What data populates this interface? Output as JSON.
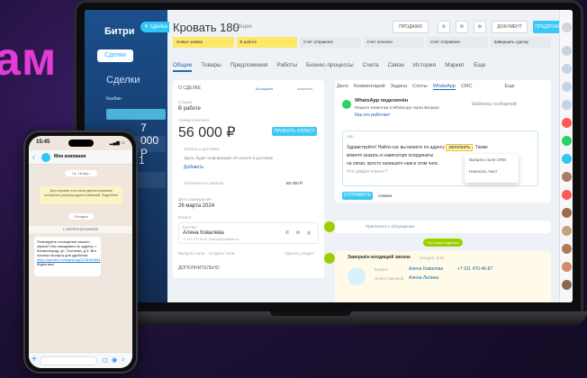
{
  "headline": "ам",
  "crm": {
    "brand": "Битри",
    "left_button": "Сделки",
    "section": "Сделки",
    "kanban": "Канбан",
    "amount_1": "7 000 Р",
    "amount_2": "1"
  },
  "deal": {
    "close_label": "сделка",
    "title": "Кровать 180",
    "subtitle": "Общие",
    "buttons": [
      "ПРОДАЖИ",
      "ДОКУМЕНТ",
      "ПРЕДЛОЖЕНИЕ"
    ],
    "stages": [
      {
        "label": "Новые заявки",
        "color": "#ffe769"
      },
      {
        "label": "В работе",
        "color": "#ffe769"
      },
      {
        "label": "Счет отправлен",
        "color": "#e6e9ed"
      },
      {
        "label": "Счет оплачен",
        "color": "#e6e9ed"
      },
      {
        "label": "Счет отправлен",
        "color": "#e6e9ed"
      },
      {
        "label": "Завершить сделку",
        "color": "#e6e9ed"
      }
    ],
    "tabs": [
      "Общие",
      "Товары",
      "Предложения",
      "Работы",
      "Бизнес-процессы",
      "Счета",
      "Связи",
      "История",
      "Маркет",
      "Еще"
    ],
    "about_title": "О СДЕЛКЕ",
    "ai_label": "AI-скоринг",
    "edit_label": "изменить",
    "stage_label": "Стадия",
    "stage_value": "В работе",
    "amount_label": "Сумма и валюта",
    "amount_value": "56 000 ₽",
    "payment_button": "ПРИНЯТЬ ОПЛАТУ",
    "payment_label": "Оплата и доставка",
    "payment_note": "Здесь будет информация об оплате и доставке",
    "add_link": "Добавить",
    "delivered": "Оплачено из заказов",
    "delivered_value": "56 000 ₽",
    "date_label": "Дата завершения",
    "date_value": "26 марта 2024",
    "client_label": "Клиент",
    "contact_label": "Контакт",
    "contact_name": "Алена Ковалева",
    "contact_phone": "+7 911 470-46-87, lhalena@lalalalala.ru",
    "select_field": "Выбрать поле",
    "create_field": "Создать поле",
    "delete_section": "Удалить раздел",
    "extra_title": "ДОПОЛНИТЕЛЬНО"
  },
  "activity": {
    "tabs": [
      "Дело",
      "Комментарий",
      "Задача",
      "Слоты",
      "WhatsApp",
      "СМС",
      "Еще"
    ],
    "wa_connected": "WhatsApp подключён",
    "wa_desc": "Пишите клиентам в WhatsApp через Битрикс",
    "how_link": "Как это работает",
    "templates": "Шаблоны сообщений",
    "from_label": "пер",
    "message_1": "Здравствуйте! Найти нас вы можете по адресу",
    "fill": "заполнить",
    "message_2": ". Также",
    "message_3": "можете указать в навигаторе координаты",
    "message_4": "на связи, просто напишите нам в этом чате.",
    "message_5": "Что увидит клиент?",
    "popup_1": "Выбрать поле CRM",
    "popup_2": "Написать текст",
    "send_button": "ОТПРАВИТЬ",
    "cancel_button": "отмена",
    "invite": "Пригласить к обсуждению",
    "need_work": "Что нужно сделать",
    "incoming_title": "Завершён входящий звонок",
    "incoming_date": "сегодня, 9:54",
    "client_label": "Клиент",
    "client_name": "Алена Ковалева",
    "client_phone": "+7 911 470-46-87",
    "responsible_label": "Ответственный",
    "responsible_name": "Алена Лилина"
  },
  "phone": {
    "time": "15:45",
    "chat_name": "Моя компания",
    "date_chip": "Чт, 18 апр.",
    "system_note": "Для отправки этих чатов данная компания пользуется услугами других компаний. Подробнее",
    "today_chip": "Сегодня",
    "unread": "1 НЕПРОЧИТАННОЕ",
    "message": "Планируете посещение нашего офиса? Мы находимся по адресу: г. Калининград, ул. Гостиная, д.3. Вот ссылка на карту для удобства:",
    "link": "https://yandex.ru/maps/org/1126159654",
    "message_end": ". Ждем вас!"
  }
}
